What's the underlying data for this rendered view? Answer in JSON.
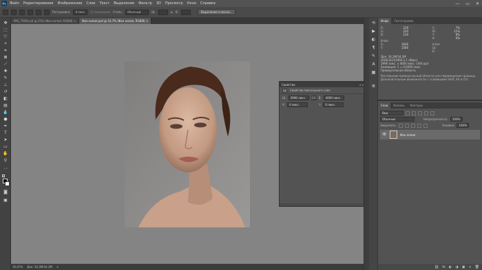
{
  "menu": {
    "logo": "Ps",
    "items": [
      "Файл",
      "Редактирование",
      "Изображение",
      "Слои",
      "Текст",
      "Выделение",
      "Фильтр",
      "3D",
      "Просмотр",
      "Окно",
      "Справка"
    ],
    "window_controls": [
      "—",
      "▭",
      "✕"
    ]
  },
  "options": {
    "feather_label": "Растушевка:",
    "feather_value": "0 пикс.",
    "antialias_label": "Сглаживание",
    "style_label": "Стиль:",
    "style_value": "Обычный",
    "width_label": "Ш:",
    "height_label": "В:",
    "select_mask_button": "Выделение и маска..."
  },
  "tabs": [
    {
      "label": "IMG_7948.psd @ 25% (Фон копия, RGB/8) ×",
      "active": false
    },
    {
      "label": "Фон копия.psd @ 16,7% (Фон копия, RGB/8) ×",
      "active": true
    }
  ],
  "status": {
    "zoom": "16,67%",
    "doc": "Док: 34,3M/34,3M",
    "arrow": ">"
  },
  "properties": {
    "tab": "Свойства",
    "controls": "«  ≡",
    "subtitle": "Свойства пиксельного слоя",
    "w_label": "Ш:",
    "w_value": "2996 пикс.",
    "go_label": "GO",
    "h_label": "В:",
    "h_value": "4000 пикс.",
    "x_label": "X:",
    "x_value": "0 пикс.",
    "y_label": "Y:",
    "y_value": "0 пикс."
  },
  "info": {
    "tabs": [
      "Инфо",
      "Гистограмма"
    ],
    "col1": [
      {
        "k": "R:",
        "v": "228"
      },
      {
        "k": "G:",
        "v": "220"
      },
      {
        "k": "B:",
        "v": "219"
      },
      {
        "k": "8-бит",
        "v": ""
      },
      {
        "k": "X:",
        "v": "1836"
      },
      {
        "k": "Y:",
        "v": "1566"
      }
    ],
    "col2": [
      {
        "k": "C:",
        "v": "7%"
      },
      {
        "k": "M:",
        "v": "11%"
      },
      {
        "k": "Y:",
        "v": "9%"
      },
      {
        "k": "K:",
        "v": "0%"
      },
      {
        "k": "8-бит",
        "v": ""
      },
      {
        "k": "Ш:",
        "v": ""
      },
      {
        "k": "В:",
        "v": ""
      }
    ],
    "doc_lines": [
      "Док: 34,3M/34,3M",
      "sRGB IEC61966-2.1 (8bpc)",
      "2996 пикс. x 4000 пикс. (300 ppi)",
      "Анимация: 1 = 0,0000 пикс.",
      "Прямоугольная область"
    ],
    "hint_lines": [
      "Растяжение прямоугольной области или перемещение границы.",
      "Дополнительные возможности: с клавишами Shift, Alt и Ctrl."
    ]
  },
  "layers": {
    "tabs": [
      "Слои",
      "Каналы",
      "Контуры"
    ],
    "filter": "Вид",
    "blend_mode": "Обычные",
    "opacity_label": "Непрозрачность:",
    "opacity_value": "100%",
    "lock_label": "Закрепить:",
    "fill_label": "Заливка:",
    "fill_value": "100%",
    "layer_name": "Фон копия",
    "footer_icons": [
      "⛓",
      "fx",
      "◐",
      "◑",
      "▣",
      "+",
      "🗑"
    ]
  }
}
